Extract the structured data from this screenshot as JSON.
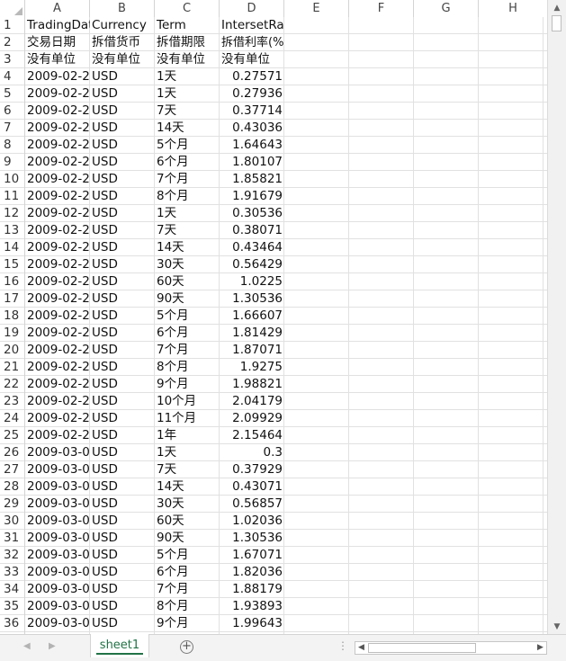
{
  "columns": [
    "A",
    "B",
    "C",
    "D",
    "E",
    "F",
    "G",
    "H"
  ],
  "sheet": {
    "tab_label": "sheet1"
  },
  "rows": [
    [
      "TradingDate",
      "Currency",
      "Term",
      "IntersetRate"
    ],
    [
      "交易日期",
      "拆借货币",
      "拆借期限",
      "拆借利率(%)"
    ],
    [
      "没有单位",
      "没有单位",
      "没有单位",
      "没有单位"
    ],
    [
      "2009-02-2",
      "USD",
      "1天",
      "0.27571"
    ],
    [
      "2009-02-2",
      "USD",
      "1天",
      "0.27936"
    ],
    [
      "2009-02-2",
      "USD",
      "7天",
      "0.37714"
    ],
    [
      "2009-02-2",
      "USD",
      "14天",
      "0.43036"
    ],
    [
      "2009-02-2",
      "USD",
      "5个月",
      "1.64643"
    ],
    [
      "2009-02-2",
      "USD",
      "6个月",
      "1.80107"
    ],
    [
      "2009-02-2",
      "USD",
      "7个月",
      "1.85821"
    ],
    [
      "2009-02-2",
      "USD",
      "8个月",
      "1.91679"
    ],
    [
      "2009-02-2",
      "USD",
      "1天",
      "0.30536"
    ],
    [
      "2009-02-2",
      "USD",
      "7天",
      "0.38071"
    ],
    [
      "2009-02-2",
      "USD",
      "14天",
      "0.43464"
    ],
    [
      "2009-02-2",
      "USD",
      "30天",
      "0.56429"
    ],
    [
      "2009-02-2",
      "USD",
      "60天",
      "1.0225"
    ],
    [
      "2009-02-2",
      "USD",
      "90天",
      "1.30536"
    ],
    [
      "2009-02-2",
      "USD",
      "5个月",
      "1.66607"
    ],
    [
      "2009-02-2",
      "USD",
      "6个月",
      "1.81429"
    ],
    [
      "2009-02-2",
      "USD",
      "7个月",
      "1.87071"
    ],
    [
      "2009-02-2",
      "USD",
      "8个月",
      "1.9275"
    ],
    [
      "2009-02-2",
      "USD",
      "9个月",
      "1.98821"
    ],
    [
      "2009-02-2",
      "USD",
      "10个月",
      "2.04179"
    ],
    [
      "2009-02-2",
      "USD",
      "11个月",
      "2.09929"
    ],
    [
      "2009-02-2",
      "USD",
      "1年",
      "2.15464"
    ],
    [
      "2009-03-0",
      "USD",
      "1天",
      "0.3"
    ],
    [
      "2009-03-0",
      "USD",
      "7天",
      "0.37929"
    ],
    [
      "2009-03-0",
      "USD",
      "14天",
      "0.43071"
    ],
    [
      "2009-03-0",
      "USD",
      "30天",
      "0.56857"
    ],
    [
      "2009-03-0",
      "USD",
      "60天",
      "1.02036"
    ],
    [
      "2009-03-0",
      "USD",
      "90天",
      "1.30536"
    ],
    [
      "2009-03-0",
      "USD",
      "5个月",
      "1.67071"
    ],
    [
      "2009-03-0",
      "USD",
      "6个月",
      "1.82036"
    ],
    [
      "2009-03-0",
      "USD",
      "7个月",
      "1.88179"
    ],
    [
      "2009-03-0",
      "USD",
      "8个月",
      "1.93893"
    ],
    [
      "2009-03-0",
      "USD",
      "9个月",
      "1.99643"
    ]
  ],
  "icons": {
    "prev_sheet": "◀",
    "next_sheet": "▶",
    "add_sheet": "+",
    "menu_dots": "⋮",
    "scroll_up": "▲",
    "scroll_down": "▼",
    "scroll_left": "◀",
    "scroll_right": "▶"
  }
}
